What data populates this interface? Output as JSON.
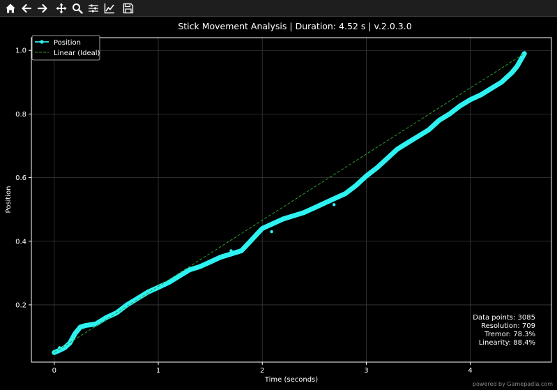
{
  "toolbar": {
    "buttons": [
      {
        "name": "home-icon"
      },
      {
        "name": "back-arrow-icon"
      },
      {
        "name": "forward-arrow-icon"
      },
      {
        "name": "pan-move-icon"
      },
      {
        "name": "zoom-magnifier-icon"
      },
      {
        "name": "configure-subplots-icon"
      },
      {
        "name": "edit-axes-icon"
      },
      {
        "name": "save-floppy-icon"
      }
    ]
  },
  "colors": {
    "background": "#000000",
    "position_series": "#2ef2f2",
    "linear_series": "#2e9e2e",
    "text": "#ffffff",
    "grid": "#3a3a3a"
  },
  "stats": {
    "data_points": "Data points: 3085",
    "resolution": "Resolution: 709",
    "tremor": "Tremor: 78.3%",
    "linearity": "Linearity: 88.4%"
  },
  "footer": "powered by Gamepadla.com",
  "chart_data": {
    "type": "line",
    "title": "Stick Movement Analysis | Duration: 4.52 s | v.2.0.3.0",
    "xlabel": "Time (seconds)",
    "ylabel": "Position",
    "xlim": [
      -0.22,
      4.78
    ],
    "ylim": [
      0.02,
      1.04
    ],
    "xticks": [
      0,
      1,
      2,
      3,
      4
    ],
    "xtick_labels": [
      "0",
      "1",
      "2",
      "3",
      "4"
    ],
    "yticks": [
      0.2,
      0.4,
      0.6,
      0.8,
      1.0
    ],
    "ytick_labels": [
      "0.2",
      "0.4",
      "0.6",
      "0.8",
      "1.0"
    ],
    "grid": true,
    "legend_position": "top-left",
    "series": [
      {
        "name": "Position",
        "style": "line-marker",
        "x": [
          0.0,
          0.05,
          0.1,
          0.15,
          0.2,
          0.25,
          0.3,
          0.4,
          0.5,
          0.6,
          0.7,
          0.8,
          0.9,
          1.0,
          1.1,
          1.2,
          1.3,
          1.4,
          1.5,
          1.6,
          1.7,
          1.8,
          1.9,
          2.0,
          2.1,
          2.2,
          2.3,
          2.4,
          2.5,
          2.6,
          2.7,
          2.8,
          2.9,
          3.0,
          3.1,
          3.2,
          3.3,
          3.4,
          3.5,
          3.6,
          3.7,
          3.8,
          3.9,
          4.0,
          4.1,
          4.2,
          4.3,
          4.4,
          4.45,
          4.52
        ],
        "y": [
          0.05,
          0.057,
          0.065,
          0.08,
          0.11,
          0.13,
          0.135,
          0.14,
          0.16,
          0.175,
          0.2,
          0.22,
          0.24,
          0.255,
          0.27,
          0.29,
          0.31,
          0.32,
          0.335,
          0.35,
          0.36,
          0.37,
          0.405,
          0.44,
          0.455,
          0.47,
          0.48,
          0.49,
          0.505,
          0.52,
          0.535,
          0.55,
          0.575,
          0.605,
          0.63,
          0.66,
          0.69,
          0.71,
          0.73,
          0.75,
          0.78,
          0.8,
          0.825,
          0.845,
          0.86,
          0.88,
          0.9,
          0.93,
          0.95,
          0.99
        ]
      },
      {
        "name": "Linear (Ideal)",
        "style": "dashed",
        "x": [
          0.0,
          4.52
        ],
        "y": [
          0.05,
          0.99
        ]
      }
    ],
    "outliers": [
      {
        "x": 2.09,
        "y": 0.43
      },
      {
        "x": 2.69,
        "y": 0.515
      },
      {
        "x": 1.7,
        "y": 0.37
      },
      {
        "x": 0.05,
        "y": 0.065
      }
    ]
  }
}
